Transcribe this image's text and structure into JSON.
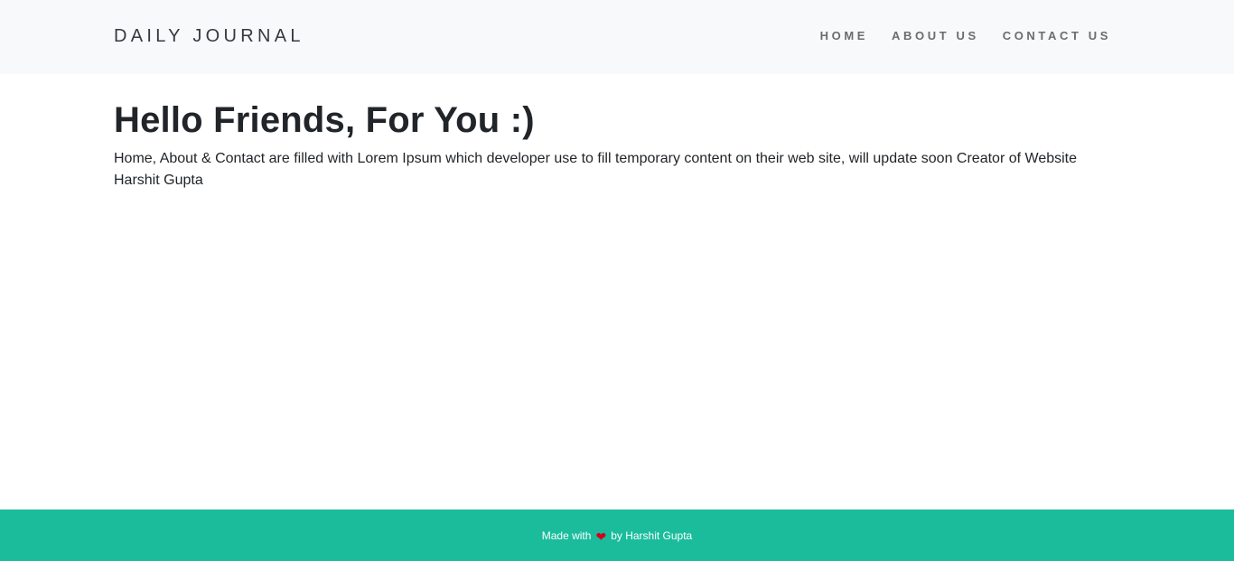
{
  "navbar": {
    "brand": "DAILY JOURNAL",
    "links": [
      {
        "label": "HOME"
      },
      {
        "label": "ABOUT US"
      },
      {
        "label": "CONTACT US"
      }
    ],
    "background": "#f8f9fa"
  },
  "main": {
    "heading": "Hello Friends, For You :)",
    "paragraph": "Home, About & Contact are filled with Lorem Ipsum which developer use to fill temporary content on their web site, will update soon Creator of Website Harshit Gupta"
  },
  "footer": {
    "text_before": "Made with",
    "icon": "heart-icon",
    "text_after": "by Harshit Gupta",
    "background": "#1abc9c"
  }
}
